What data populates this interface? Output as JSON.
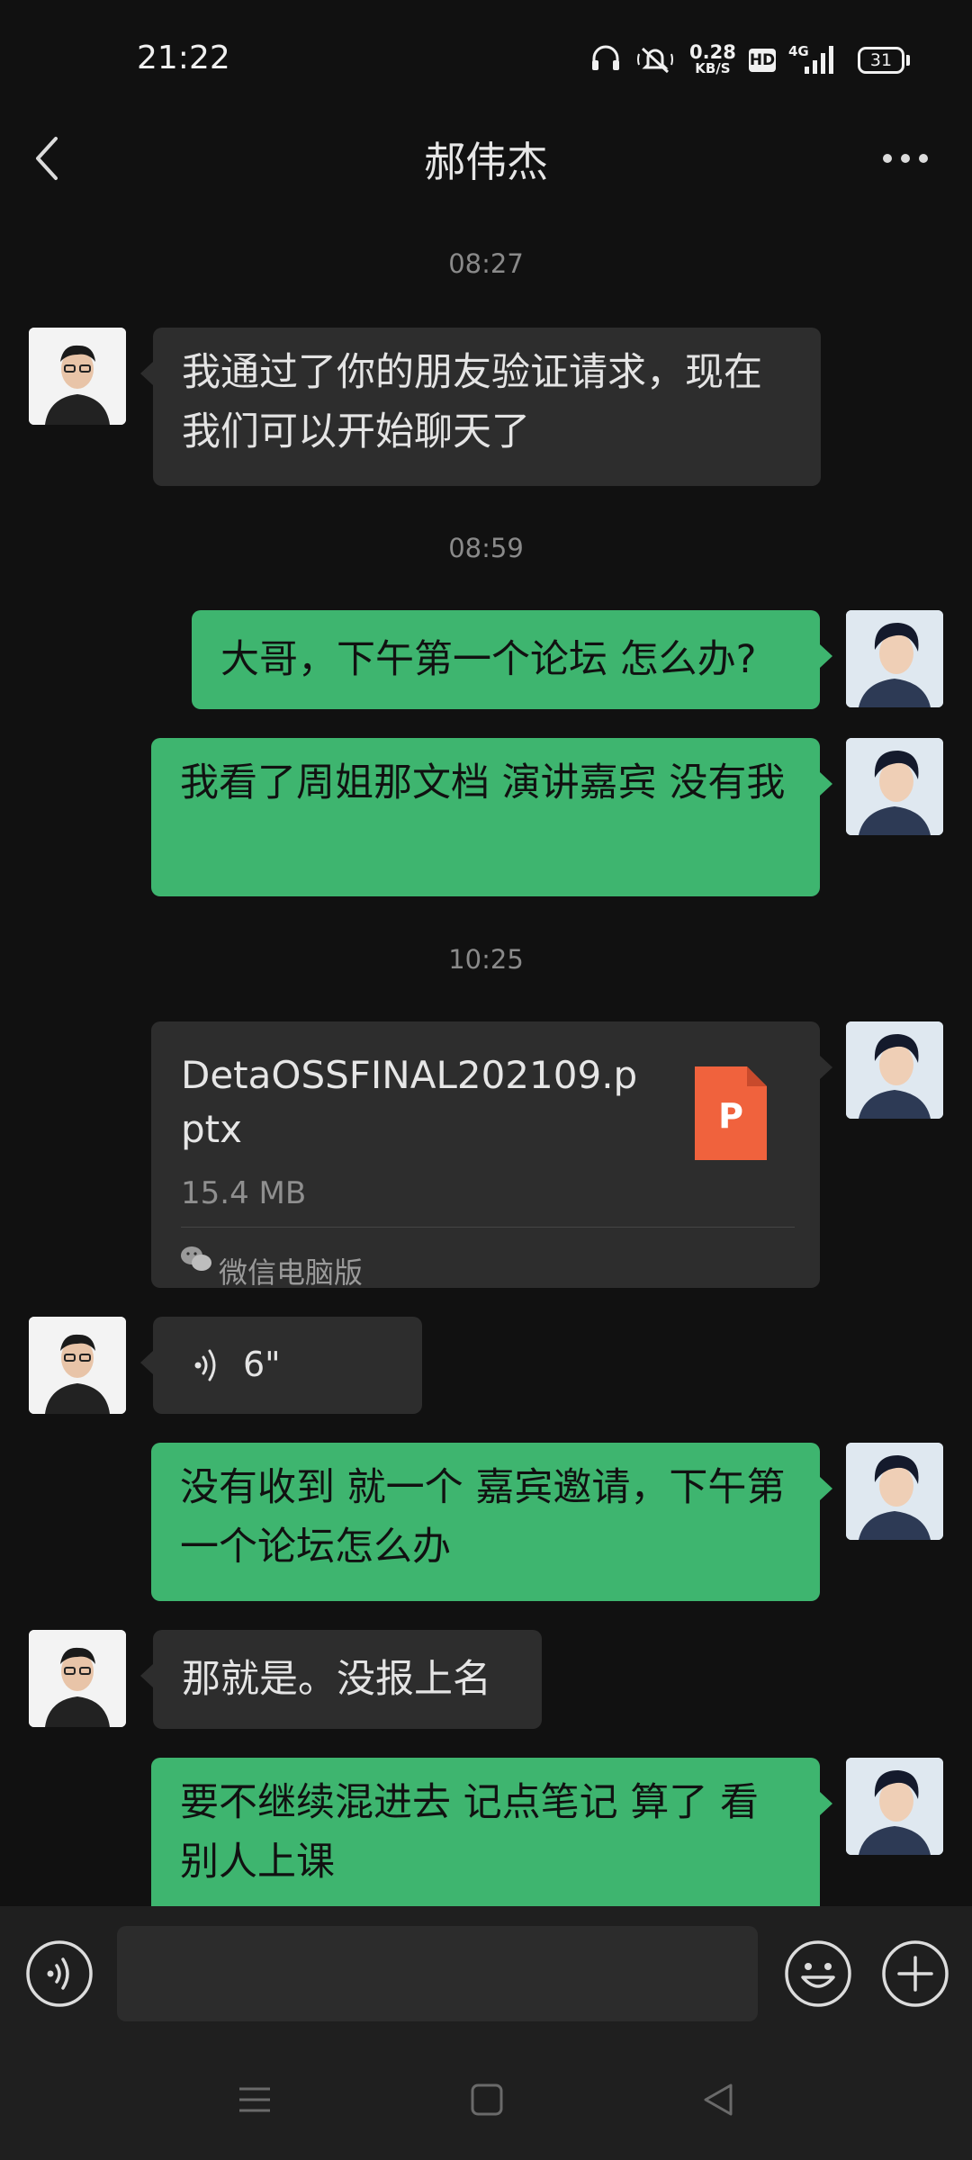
{
  "status_bar": {
    "time": "21:22",
    "speed_value": "0.28",
    "speed_unit": "KB/S",
    "hd": "HD",
    "network": "4G",
    "battery": "31",
    "icons": [
      "headphones-icon",
      "mute-icon",
      "signal-icon",
      "battery-icon"
    ]
  },
  "header": {
    "title": "郝伟杰",
    "back_icon": "chevron-left-icon",
    "more_icon": "more-dots-icon"
  },
  "messages": [
    {
      "type": "timestamp",
      "text": "08:27"
    },
    {
      "type": "text",
      "side": "in",
      "text": "我通过了你的朋友验证请求，现在我们可以开始聊天了"
    },
    {
      "type": "timestamp",
      "text": "08:59"
    },
    {
      "type": "text",
      "side": "out",
      "text": "大哥，下午第一个论坛 怎么办?"
    },
    {
      "type": "text",
      "side": "out",
      "text": "我看了周姐那文档 演讲嘉宾 没有我"
    },
    {
      "type": "timestamp",
      "text": "10:25"
    },
    {
      "type": "file",
      "side": "out",
      "file_name": "DetaOSSFINAL202109.pptx",
      "file_size": "15.4 MB",
      "file_icon_letter": "P",
      "source": "微信电脑版"
    },
    {
      "type": "voice",
      "side": "in",
      "duration": "6\""
    },
    {
      "type": "text",
      "side": "out",
      "text": "没有收到 就一个 嘉宾邀请，下午第一个论坛怎么办"
    },
    {
      "type": "text",
      "side": "in",
      "text": "那就是。没报上名"
    },
    {
      "type": "text",
      "side": "out",
      "text": "要不继续混进去 记点笔记 算了 看别人上课"
    }
  ],
  "input_bar": {
    "placeholder": "",
    "icons": [
      "voice-input-icon",
      "emoji-icon",
      "plus-icon"
    ]
  },
  "nav_bar": {
    "icons": [
      "menu-icon",
      "home-icon",
      "back-nav-icon"
    ]
  },
  "colors": {
    "background": "#111111",
    "incoming_bubble": "#2d2d2d",
    "outgoing_bubble": "#3eb56f",
    "file_icon": "#f0623d"
  }
}
